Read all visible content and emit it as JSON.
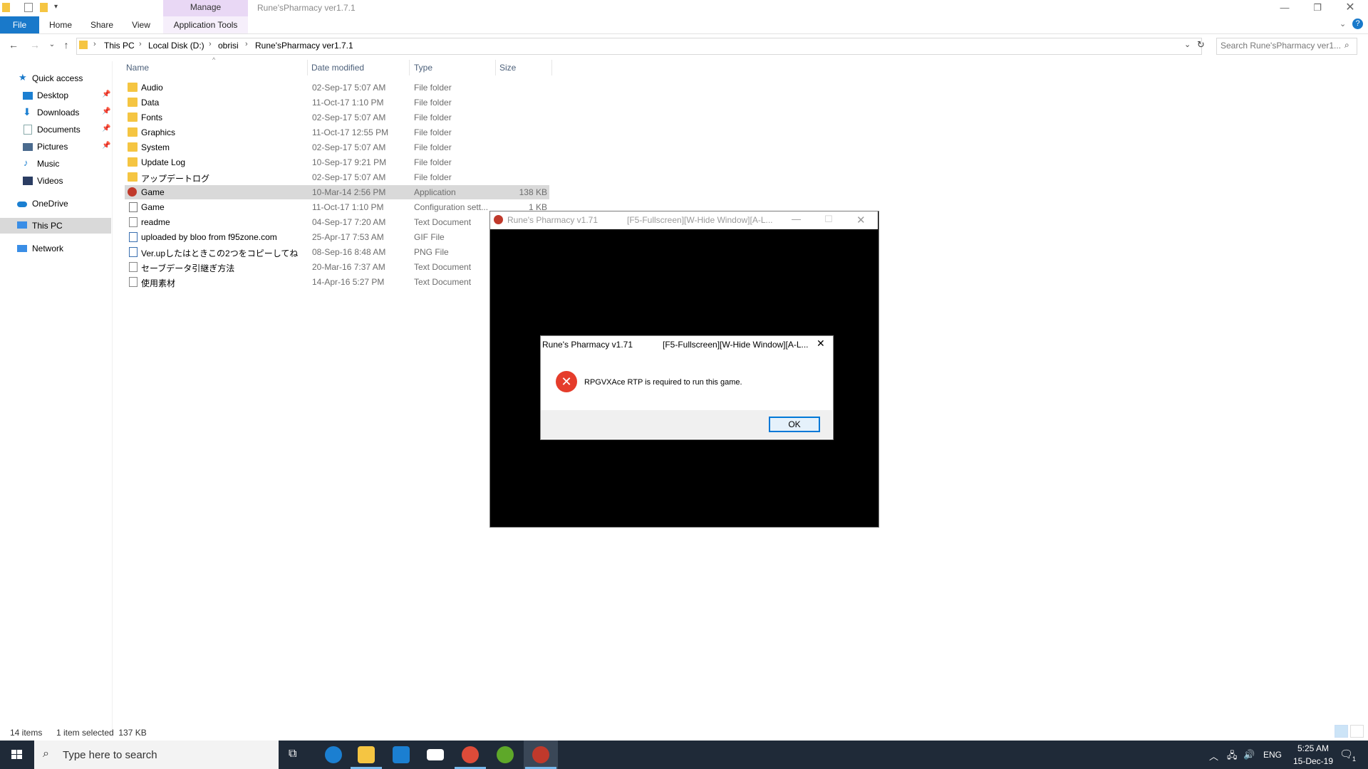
{
  "window": {
    "title": "Rune'sPharmacy ver1.7.1",
    "manage_label": "Manage"
  },
  "ribbon": {
    "tabs": [
      "File",
      "Home",
      "Share",
      "View",
      "Application Tools"
    ]
  },
  "address": {
    "breadcrumbs": [
      "This PC",
      "Local Disk (D:)",
      "obrisi",
      "Rune'sPharmacy ver1.7.1"
    ],
    "search_placeholder": "Search Rune'sPharmacy ver1..."
  },
  "nav": {
    "items": [
      {
        "label": "Quick access",
        "icon": "star-icon"
      },
      {
        "label": "Desktop",
        "icon": "desktop-icon",
        "pinned": true
      },
      {
        "label": "Downloads",
        "icon": "download-icon",
        "pinned": true
      },
      {
        "label": "Documents",
        "icon": "documents-icon",
        "pinned": true
      },
      {
        "label": "Pictures",
        "icon": "pictures-icon",
        "pinned": true
      },
      {
        "label": "Music",
        "icon": "music-icon"
      },
      {
        "label": "Videos",
        "icon": "videos-icon"
      },
      {
        "label": "OneDrive",
        "icon": "cloud-icon"
      },
      {
        "label": "This PC",
        "icon": "computer-icon",
        "selected": true
      },
      {
        "label": "Network",
        "icon": "network-icon"
      }
    ]
  },
  "columns": {
    "name": "Name",
    "date": "Date modified",
    "type": "Type",
    "size": "Size"
  },
  "files": [
    {
      "name": "Audio",
      "date": "02-Sep-17 5:07 AM",
      "type": "File folder",
      "size": "",
      "icon": "folder-icon"
    },
    {
      "name": "Data",
      "date": "11-Oct-17 1:10 PM",
      "type": "File folder",
      "size": "",
      "icon": "folder-icon"
    },
    {
      "name": "Fonts",
      "date": "02-Sep-17 5:07 AM",
      "type": "File folder",
      "size": "",
      "icon": "folder-icon"
    },
    {
      "name": "Graphics",
      "date": "11-Oct-17 12:55 PM",
      "type": "File folder",
      "size": "",
      "icon": "folder-icon"
    },
    {
      "name": "System",
      "date": "02-Sep-17 5:07 AM",
      "type": "File folder",
      "size": "",
      "icon": "folder-icon"
    },
    {
      "name": "Update Log",
      "date": "10-Sep-17 9:21 PM",
      "type": "File folder",
      "size": "",
      "icon": "folder-icon"
    },
    {
      "name": "アップデートログ",
      "date": "02-Sep-17 5:07 AM",
      "type": "File folder",
      "size": "",
      "icon": "folder-icon"
    },
    {
      "name": "Game",
      "date": "10-Mar-14 2:56 PM",
      "type": "Application",
      "size": "138 KB",
      "icon": "app-icon",
      "selected": true
    },
    {
      "name": "Game",
      "date": "11-Oct-17 1:10 PM",
      "type": "Configuration sett...",
      "size": "1 KB",
      "icon": "config-icon"
    },
    {
      "name": "readme",
      "date": "04-Sep-17 7:20 AM",
      "type": "Text Document",
      "size": "",
      "icon": "text-file-icon"
    },
    {
      "name": "uploaded by bloo from f95zone.com",
      "date": "25-Apr-17 7:53 AM",
      "type": "GIF File",
      "size": "",
      "icon": "image-file-icon"
    },
    {
      "name": "Ver.upしたはときこの2つをコピーしてね",
      "date": "08-Sep-16 8:48 AM",
      "type": "PNG File",
      "size": "",
      "icon": "image-file-icon"
    },
    {
      "name": "セーブデータ引継ぎ方法",
      "date": "20-Mar-16 7:37 AM",
      "type": "Text Document",
      "size": "",
      "icon": "text-file-icon"
    },
    {
      "name": "使用素材",
      "date": "14-Apr-16 5:27 PM",
      "type": "Text Document",
      "size": "",
      "icon": "text-file-icon"
    }
  ],
  "status": {
    "count": "14 items",
    "selection": "1 item selected  137 KB"
  },
  "game_window": {
    "title": "Rune's Pharmacy v1.71",
    "keys": "[F5-Fullscreen][W-Hide Window][A-L..."
  },
  "dialog": {
    "title": "Rune's Pharmacy v1.71",
    "keys": "[F5-Fullscreen][W-Hide Window][A-L...",
    "message": "RPGVXAce RTP is required to run this game.",
    "ok_label": "OK"
  },
  "taskbar": {
    "search_placeholder": "Type here to search",
    "language": "ENG",
    "time": "5:25 AM",
    "date": "15-Dec-19",
    "notifications": "1"
  },
  "colors": {
    "file_tab": "#1979ca",
    "manage_tab": "#e9d8f5",
    "selection": "#d9d9d9",
    "taskbar": "#1f2a38",
    "error": "#e53c2b"
  }
}
